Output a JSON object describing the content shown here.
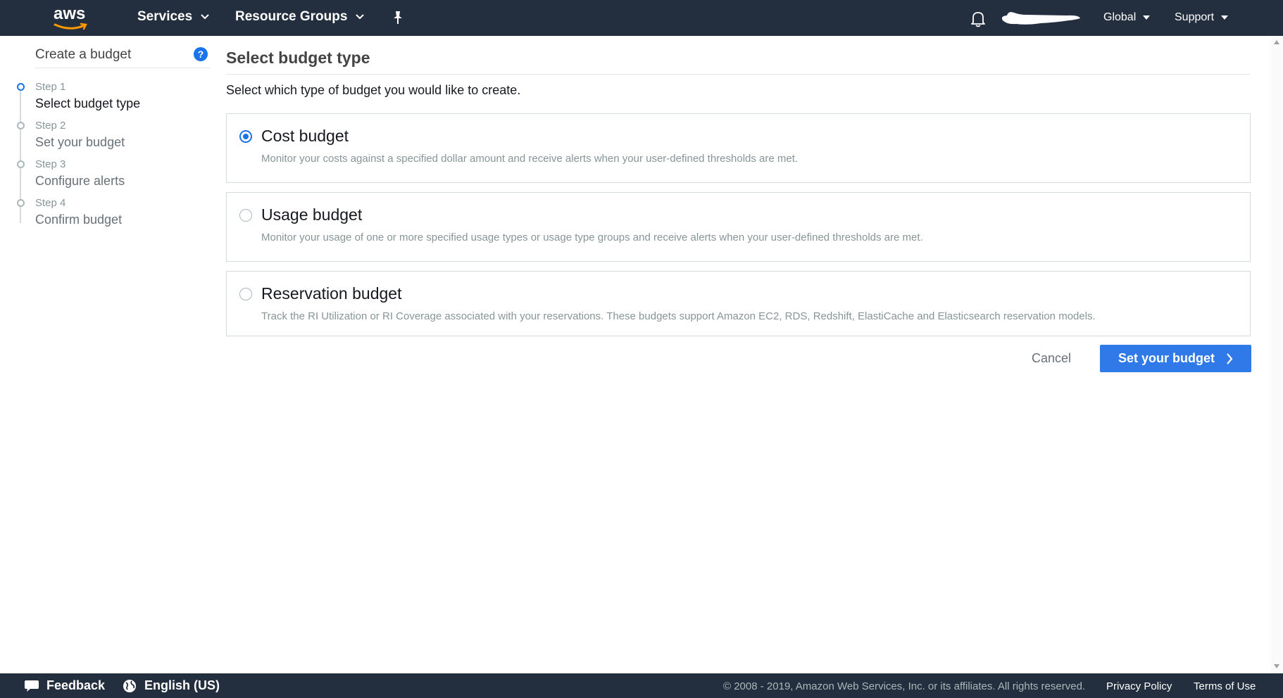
{
  "nav": {
    "logo": "aws",
    "services": "Services",
    "resource_groups": "Resource Groups",
    "global": "Global",
    "support": "Support"
  },
  "sidebar": {
    "title": "Create a budget",
    "steps": [
      {
        "num": "Step 1",
        "label": "Select budget type",
        "active": true
      },
      {
        "num": "Step 2",
        "label": "Set your budget",
        "active": false
      },
      {
        "num": "Step 3",
        "label": "Configure alerts",
        "active": false
      },
      {
        "num": "Step 4",
        "label": "Confirm budget",
        "active": false
      }
    ]
  },
  "main": {
    "title": "Select budget type",
    "subtitle": "Select which type of budget you would like to create.",
    "options": [
      {
        "title": "Cost budget",
        "description": "Monitor your costs against a specified dollar amount and receive alerts when your user-defined thresholds are met.",
        "selected": true
      },
      {
        "title": "Usage budget",
        "description": "Monitor your usage of one or more specified usage types or usage type groups and receive alerts when your user-defined thresholds are met.",
        "selected": false
      },
      {
        "title": "Reservation budget",
        "description": "Track the RI Utilization or RI Coverage associated with your reservations. These budgets support Amazon EC2, RDS, Redshift, ElastiCache and Elasticsearch reservation models.",
        "selected": false
      }
    ],
    "cancel": "Cancel",
    "next": "Set your budget"
  },
  "footer": {
    "feedback": "Feedback",
    "language": "English (US)",
    "copyright": "© 2008 - 2019, Amazon Web Services, Inc. or its affiliates. All rights reserved.",
    "privacy": "Privacy Policy",
    "terms": "Terms of Use"
  },
  "colors": {
    "nav_bg": "#232f3e",
    "primary": "#2f7ae8",
    "accent_smile": "#ff9900"
  }
}
